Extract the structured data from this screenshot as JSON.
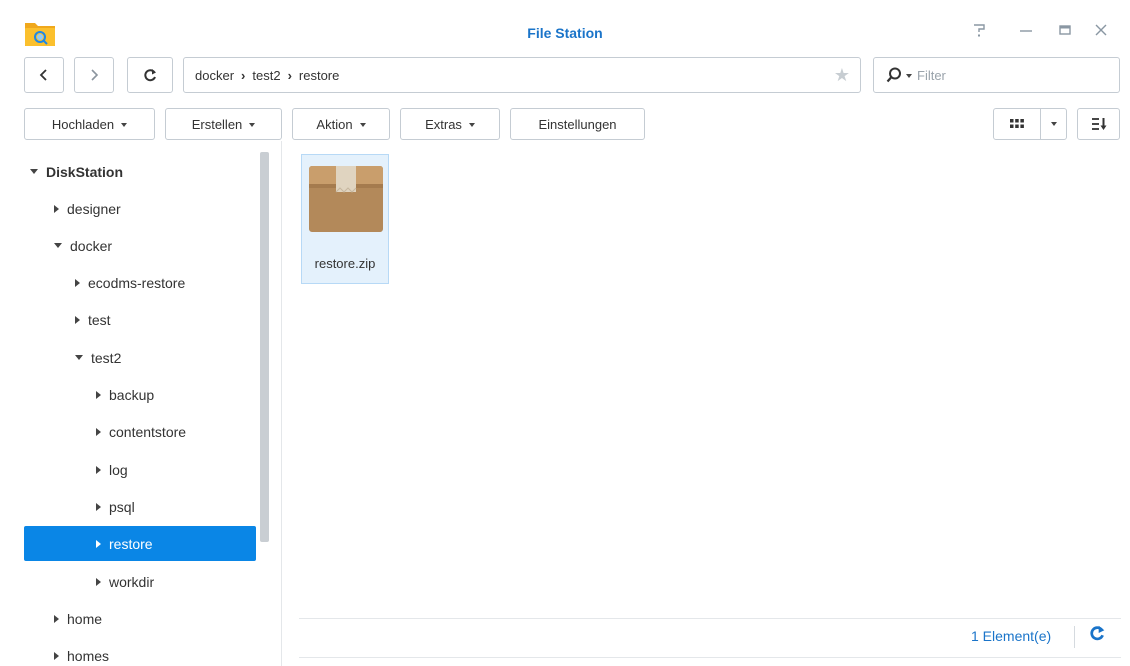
{
  "window": {
    "title": "File Station"
  },
  "nav": {
    "back_icon": "chevron-left-icon",
    "forward_icon": "chevron-right-icon",
    "refresh_icon": "refresh-icon"
  },
  "path": {
    "segments": [
      "docker",
      "test2",
      "restore"
    ],
    "favorite_icon": "star-icon"
  },
  "filter": {
    "placeholder": "Filter",
    "icon": "search-icon"
  },
  "toolbar": {
    "upload": "Hochladen",
    "create": "Erstellen",
    "action": "Aktion",
    "extras": "Extras",
    "settings": "Einstellungen"
  },
  "tree": {
    "root": "DiskStation",
    "items": [
      {
        "label": "designer",
        "expanded": false
      },
      {
        "label": "docker",
        "expanded": true
      },
      {
        "label": "ecodms-restore",
        "expanded": false
      },
      {
        "label": "test",
        "expanded": false
      },
      {
        "label": "test2",
        "expanded": true
      },
      {
        "label": "backup",
        "expanded": false
      },
      {
        "label": "contentstore",
        "expanded": false
      },
      {
        "label": "log",
        "expanded": false
      },
      {
        "label": "psql",
        "expanded": false
      },
      {
        "label": "restore",
        "expanded": false,
        "selected": true
      },
      {
        "label": "workdir",
        "expanded": false
      },
      {
        "label": "home",
        "expanded": false
      },
      {
        "label": "homes",
        "expanded": false
      }
    ]
  },
  "files": [
    {
      "name": "restore.zip",
      "icon": "archive-box-icon"
    }
  ],
  "status": {
    "count": "1 Element(e)"
  },
  "colors": {
    "accent": "#1a74c9",
    "selection": "#0a86e6"
  }
}
